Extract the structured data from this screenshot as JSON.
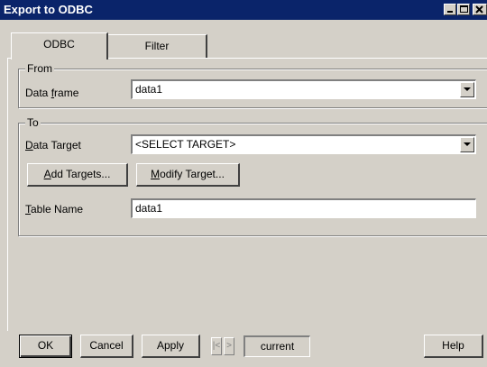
{
  "window": {
    "title": "Export to ODBC"
  },
  "tabs": [
    {
      "label": "ODBC",
      "active": true
    },
    {
      "label": "Filter",
      "active": false
    }
  ],
  "from_group": {
    "title": "From",
    "data_frame": {
      "label": "Data frame",
      "value": "data1"
    }
  },
  "to_group": {
    "title": "To",
    "data_target": {
      "label": "Data Target",
      "value": "<SELECT TARGET>"
    },
    "add_targets_label": "Add Targets...",
    "modify_target_label": "Modify Target...",
    "table_name": {
      "label": "Table Name",
      "value": "data1"
    }
  },
  "footer": {
    "ok_label": "OK",
    "cancel_label": "Cancel",
    "apply_label": "Apply",
    "current_label": "current",
    "help_label": "Help"
  }
}
